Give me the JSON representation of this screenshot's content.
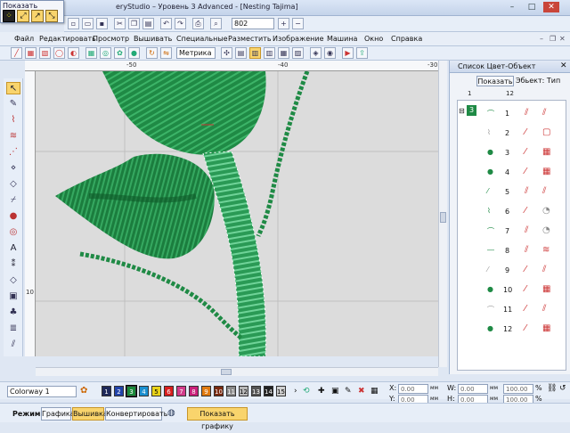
{
  "window": {
    "title": "eryStudio – Уровень 3 Advanced - [Nesting       Tajima]",
    "popup_title": "Показать",
    "zoom": "802",
    "controls": [
      "–",
      "□",
      "✕"
    ]
  },
  "menu": {
    "items": [
      "Файл",
      "Редактировать",
      "Просмотр",
      "Вышивать",
      "Специальные",
      "Разместить",
      "Изображение",
      "Машина",
      "Окно",
      "Справка"
    ]
  },
  "toolbar2": {
    "units": "Метрика"
  },
  "rulers": {
    "top": [
      "-50",
      "-40",
      "-30"
    ],
    "left": [
      "10"
    ]
  },
  "panel": {
    "title": "Список Цвет-Объект",
    "show_button": "Показать",
    "scheme_label": "Эбьект: Тип",
    "col1": "1",
    "col2": "12",
    "group_number": "3",
    "rows": [
      "1",
      "2",
      "3",
      "4",
      "5",
      "6",
      "7",
      "8",
      "9",
      "10",
      "11",
      "12"
    ]
  },
  "bottom": {
    "colorway": "Colorway 1",
    "swatches": [
      {
        "label": "1",
        "color": "#1f2a5a"
      },
      {
        "label": "2",
        "color": "#2244aa"
      },
      {
        "label": "3",
        "color": "#1a8a3a"
      },
      {
        "label": "4",
        "color": "#1a8fd0"
      },
      {
        "label": "5",
        "color": "#e8d21a"
      },
      {
        "label": "6",
        "color": "#d81f1f"
      },
      {
        "label": "7",
        "color": "#d23c8a"
      },
      {
        "label": "8",
        "color": "#c8207a"
      },
      {
        "label": "9",
        "color": "#e07a10"
      },
      {
        "label": "10",
        "color": "#7a2a10"
      },
      {
        "label": "11",
        "color": "#8a8a8a"
      },
      {
        "label": "12",
        "color": "#b8b8b8"
      },
      {
        "label": "13",
        "color": "#555555"
      },
      {
        "label": "14",
        "color": "#222222"
      },
      {
        "label": "15",
        "color": "#d0d0d0"
      }
    ],
    "x_label": "X:",
    "x_val": "0.00",
    "y_label": "Y:",
    "y_val": "0.00",
    "w_label": "W:",
    "w_val": "0.00",
    "h_label": "H:",
    "h_val": "0.00",
    "unit": "мм",
    "pct1": "100.00",
    "pct2": "100.00",
    "pct_sign": "%"
  },
  "modes": {
    "label": "Режим:",
    "graphics": "Графика",
    "embroidery": "Вышивка",
    "convert": "Конвертировать",
    "show_graphics": "Показать графику"
  },
  "colors": {
    "accent": "#f9d46c",
    "thread": "#1f8a45",
    "highlight": "#2ea35a"
  }
}
